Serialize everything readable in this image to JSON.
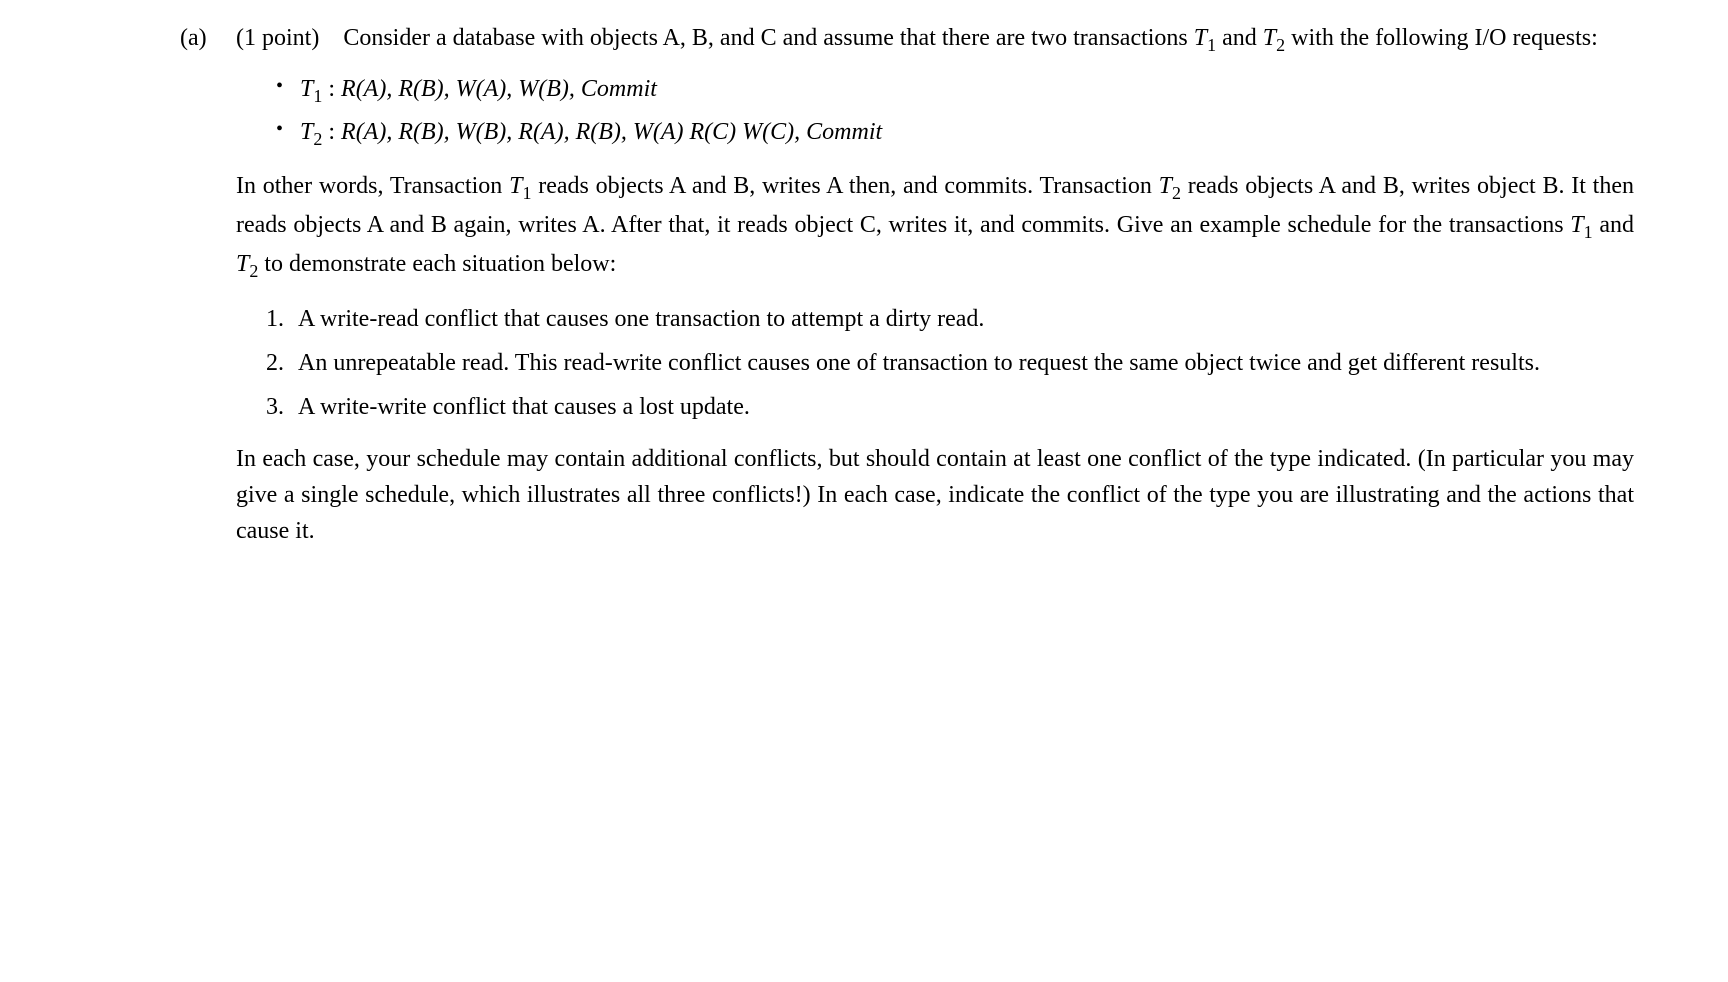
{
  "part": {
    "label": "(a)",
    "points": "(1 point)",
    "intro_prefix": "Consider a database with objects A, B, and C and assume that there are two transactions ",
    "intro_t1": "T",
    "intro_sub1": "1",
    "intro_and": " and ",
    "intro_t2": "T",
    "intro_sub2": "2",
    "intro_suffix": " with the following I/O requests:"
  },
  "bullets": [
    {
      "label": "T",
      "sub": "1",
      "colon": " : ",
      "ops": "R(A),  R(B),  W(A),  W(B),  Commit"
    },
    {
      "label": "T",
      "sub": "2",
      "colon": " : ",
      "ops": "R(A),  R(B),  W(B), R(A),  R(B),  W(A) R(C) W(C),  Commit"
    }
  ],
  "description": {
    "p1a": "In other words, Transaction ",
    "p1_t1": "T",
    "p1_s1": "1",
    "p1b": " reads objects A and B, writes A then, and commits. Transaction ",
    "p1_t2": "T",
    "p1_s2": "2",
    "p1c": " reads objects A and B, writes object B. It then reads objects A and B again, writes A. After that, it reads object C, writes it, and commits. Give an example schedule for the transactions ",
    "p1_t3": "T",
    "p1_s3": "1",
    "p1d": " and ",
    "p1_t4": "T",
    "p1_s4": "2",
    "p1e": " to demonstrate each situation below:"
  },
  "enum": [
    {
      "num": "1.",
      "text": "A write-read conflict that causes one transaction to attempt a dirty read."
    },
    {
      "num": "2.",
      "text": "An unrepeatable read.  This read-write conflict causes one of transaction to request the same object twice and get different results."
    },
    {
      "num": "3.",
      "text": "A write-write conflict that causes a lost update."
    }
  ],
  "closing": "In each case, your schedule may contain additional conflicts, but should contain at least one conflict of the type indicated.  (In particular you may give a single schedule, which illustrates all three conflicts!)  In each case, indicate the conflict of the type you are illustrating and the actions that cause it."
}
